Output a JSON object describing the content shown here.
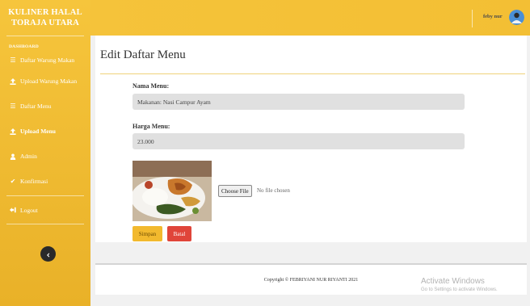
{
  "brand": {
    "line1": "KULINER HALAL",
    "line2": "TORAJA UTARA"
  },
  "sidebar": {
    "heading": "DASHBOARD",
    "items": [
      {
        "label": "Daftar Warung Makan",
        "icon": "list-icon"
      },
      {
        "label": "Upload Warung Makan",
        "icon": "upload-icon"
      },
      {
        "label": "Daftar Menu",
        "icon": "list-icon"
      },
      {
        "label": "Upload Menu",
        "icon": "upload-icon"
      },
      {
        "label": "Admin",
        "icon": "user-icon"
      },
      {
        "label": "Konfirmasi",
        "icon": "check-icon"
      }
    ],
    "logout": {
      "label": "Logout",
      "icon": "logout-icon"
    }
  },
  "topbar": {
    "username": "feby nur"
  },
  "page": {
    "title": "Edit Daftar Menu",
    "fields": {
      "nama_label": "Nama Menu:",
      "nama_value": "Makanan: Nasi Campur Ayam",
      "harga_label": "Harga Menu:",
      "harga_value": "23.000"
    },
    "file": {
      "button_label": "Choose File",
      "status": "No file chosen"
    },
    "buttons": {
      "save": "Simpan",
      "cancel": "Batal"
    }
  },
  "footer": {
    "text": "Copyright © FEBRIYANI NUR RIYANTI 2021"
  },
  "watermark": {
    "line1": "Activate Windows",
    "line2": "Go to Settings to activate Windows."
  },
  "colors": {
    "sidebar": "#f6c53c",
    "topbar": "#f5c33a",
    "save": "#f2b92e",
    "cancel": "#e0453a"
  }
}
